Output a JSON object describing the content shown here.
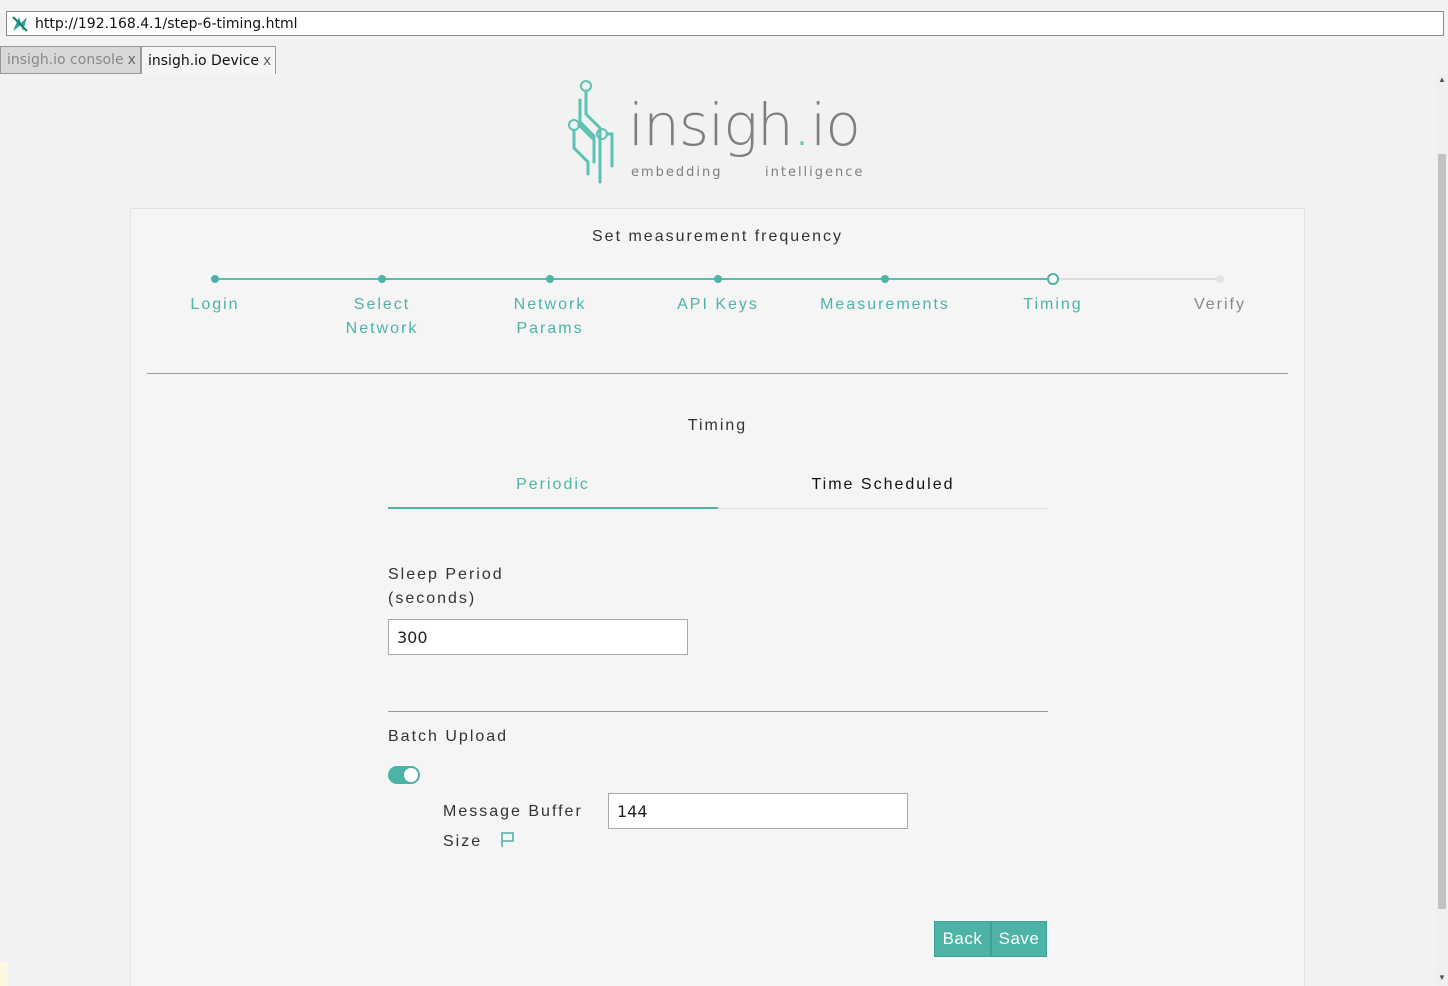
{
  "browser": {
    "url": "http://192.168.4.1/step-6-timing.html",
    "tabs": [
      {
        "label": "insigh.io console",
        "close": "x",
        "active": false
      },
      {
        "label": "insigh.io Device",
        "close": "x",
        "active": true
      }
    ]
  },
  "logo": {
    "brand_main": "insigh",
    "brand_dot": ".",
    "brand_tail": "io",
    "tagline_left": "embedding",
    "tagline_right": "intelligence"
  },
  "page": {
    "title": "Set measurement frequency"
  },
  "stepper": {
    "steps": [
      {
        "label": "Login",
        "state": "done"
      },
      {
        "label": "Select Network",
        "state": "done"
      },
      {
        "label": "Network Params",
        "state": "done"
      },
      {
        "label": "API Keys",
        "state": "done"
      },
      {
        "label": "Measurements",
        "state": "done"
      },
      {
        "label": "Timing",
        "state": "current"
      },
      {
        "label": "Verify",
        "state": "future"
      }
    ]
  },
  "timing": {
    "section_title": "Timing",
    "tabs": {
      "periodic": "Periodic",
      "scheduled": "Time Scheduled"
    },
    "sleep_period": {
      "label_line1": "Sleep Period",
      "label_line2": "(seconds)",
      "value": "300"
    },
    "batch_upload": {
      "label": "Batch Upload",
      "enabled": true,
      "buffer_label_line1": "Message Buffer",
      "buffer_label_line2": "Size",
      "buffer_value": "144",
      "info_icon": "flag-icon"
    }
  },
  "buttons": {
    "back": "Back",
    "save": "Save"
  },
  "colors": {
    "accent": "#4db3a6",
    "background": "#f2f2f2"
  }
}
